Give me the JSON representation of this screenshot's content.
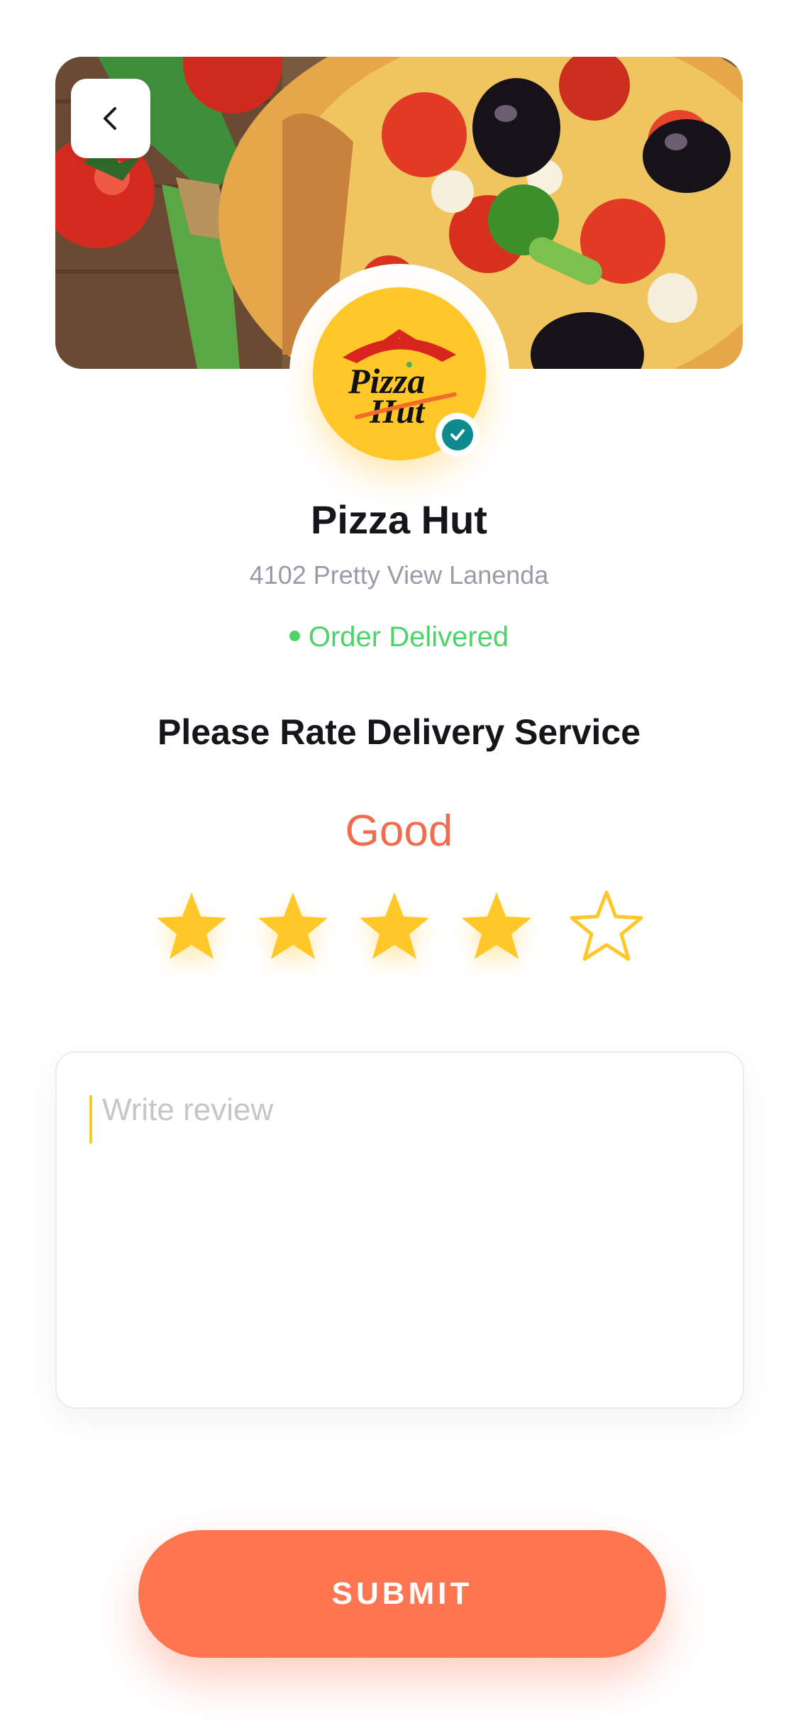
{
  "header": {
    "back_icon": "chevron-left-icon",
    "banner_image": "pizza-photo"
  },
  "restaurant": {
    "name": "Pizza Hut",
    "address": "4102  Pretty View Lanenda",
    "status": "Order Delivered",
    "verified_icon": "check-circle-icon",
    "logo": {
      "line1": "Pizza",
      "line2": "Hut"
    }
  },
  "rating": {
    "prompt": "Please Rate Delivery Service",
    "label": "Good",
    "value": 4,
    "max": 5
  },
  "review": {
    "placeholder": "Write review",
    "value": ""
  },
  "actions": {
    "submit_label": "SUBMIT"
  },
  "colors": {
    "accent": "#ff7550",
    "star": "#ffc727",
    "status": "#4cd36a",
    "verified": "#0d8a8d",
    "rating_word": "#f26c4f"
  }
}
